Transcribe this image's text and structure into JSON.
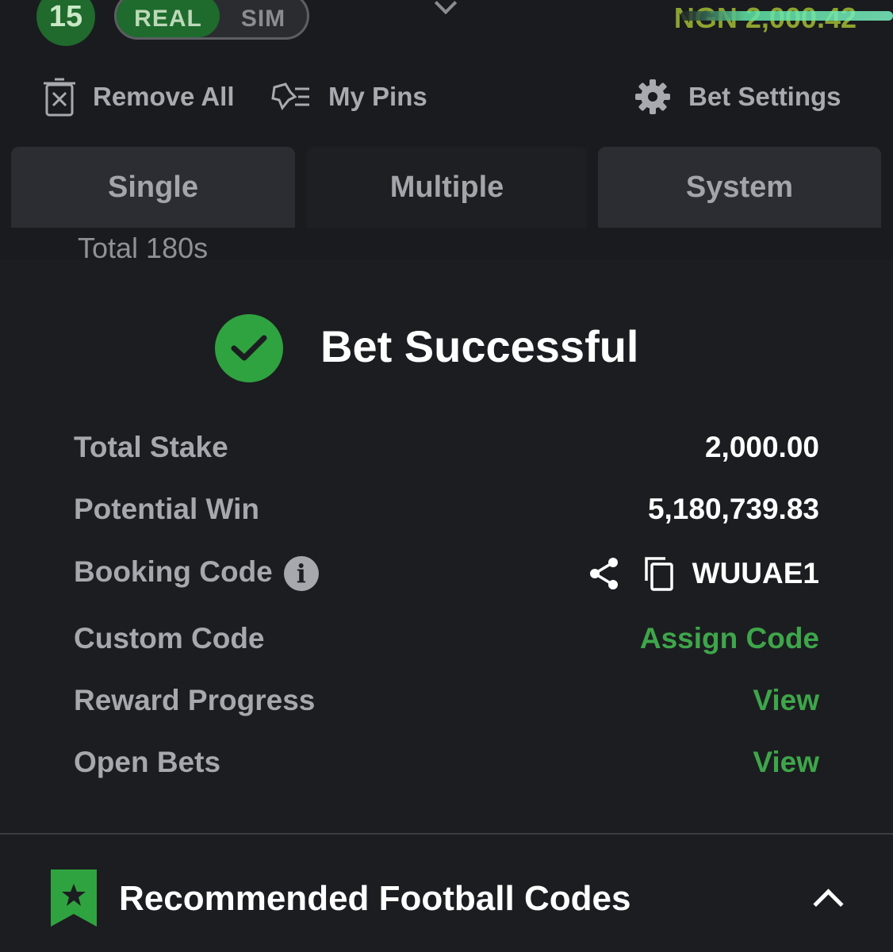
{
  "header": {
    "bet_count": "15",
    "mode_real": "REAL",
    "mode_sim": "SIM",
    "balance": "NGN 2,000.42"
  },
  "toolbar": {
    "remove_all": "Remove All",
    "my_pins": "My Pins",
    "bet_settings": "Bet Settings"
  },
  "tabs": [
    {
      "label": "Single"
    },
    {
      "label": "Multiple"
    },
    {
      "label": "System"
    }
  ],
  "active_tab": "Multiple",
  "total_label": "Total 180s",
  "success": {
    "title": "Bet Successful",
    "rows": [
      {
        "label": "Total Stake",
        "value": "2,000.00"
      },
      {
        "label": "Potential Win",
        "value": "5,180,739.83"
      },
      {
        "label": "Booking Code",
        "value": "WUUAE1"
      },
      {
        "label": "Custom Code",
        "value": "Assign Code"
      },
      {
        "label": "Reward Progress",
        "value": "View"
      },
      {
        "label": "Open Bets",
        "value": "View"
      }
    ]
  },
  "recommended": {
    "title": "Recommended Football Codes"
  },
  "icons": {
    "remove_all": "trash-x-icon",
    "my_pins": "pin-list-icon",
    "bet_settings": "gear-icon",
    "success": "check-circle-icon",
    "info": "info-icon",
    "share": "share-icon",
    "copy": "copy-icon",
    "bookmark": "star-bookmark-icon",
    "collapse": "chevron-up-icon"
  },
  "colors": {
    "accent_green": "#3ea64a",
    "success_green": "#2fa33f",
    "background": "#1c1d21"
  }
}
